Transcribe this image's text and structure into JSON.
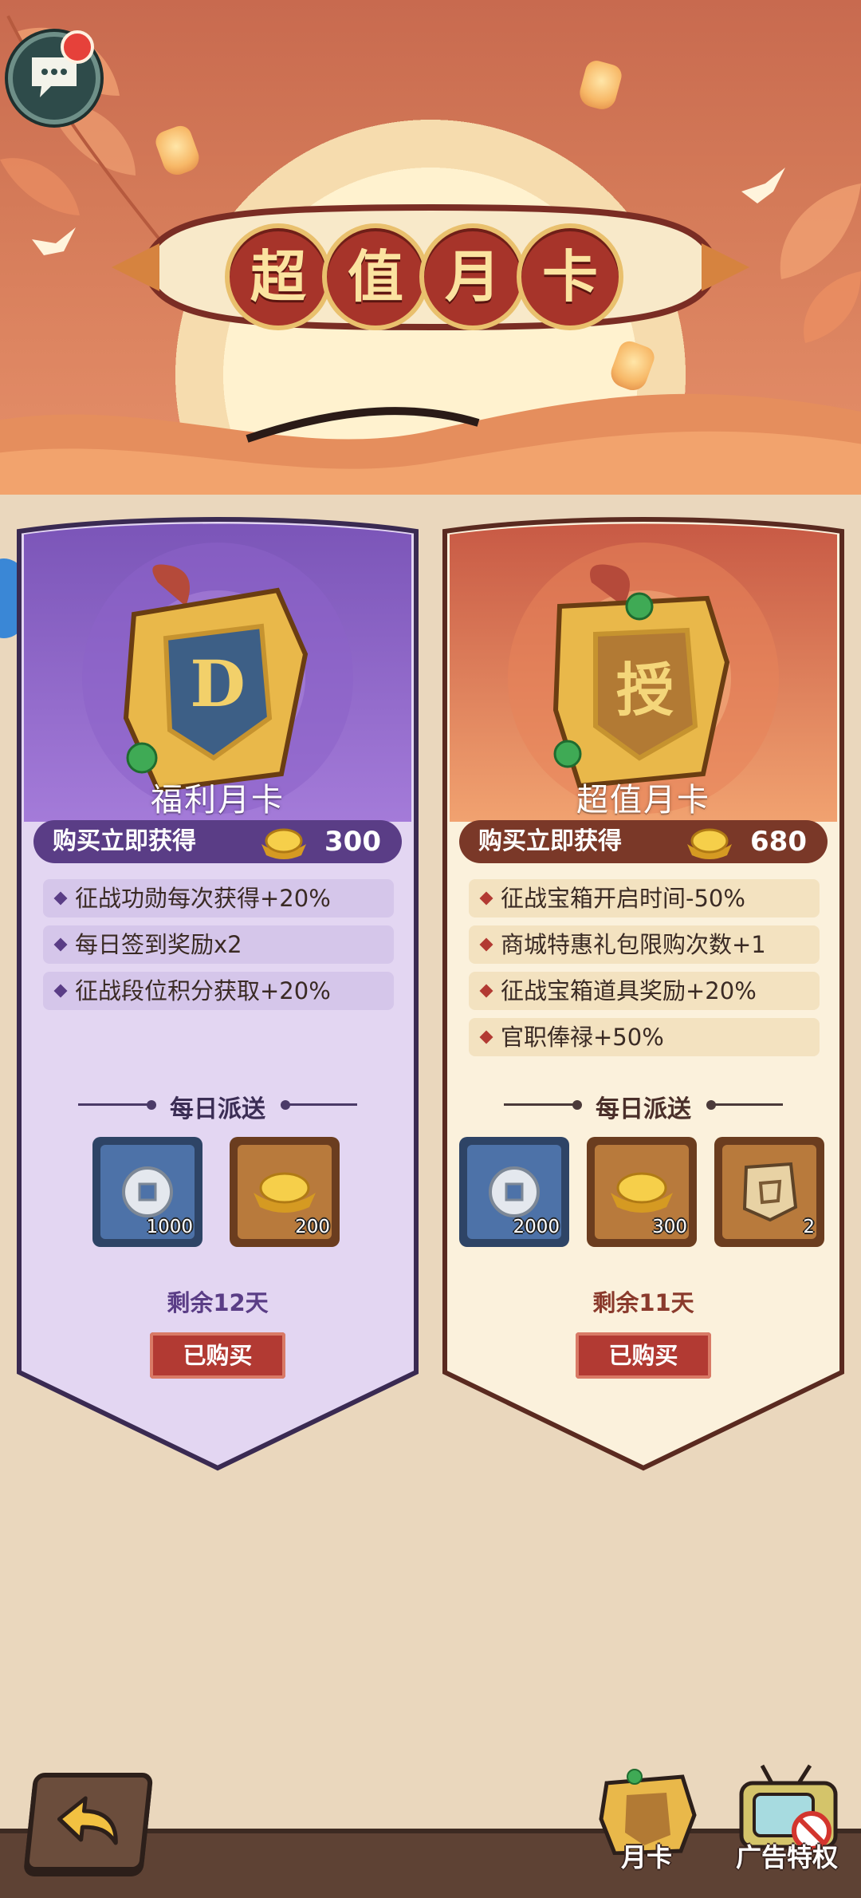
{
  "header": {
    "title_chars": [
      "超",
      "值",
      "月",
      "卡"
    ]
  },
  "cards": [
    {
      "name": "福利月卡",
      "emblem_glyph": "D",
      "instant_label": "购买立即获得",
      "instant_amount": "300",
      "benefits": [
        "征战功勋每次获得+20%",
        "每日签到奖励x2",
        "征战段位积分获取+20%"
      ],
      "daily_title": "每日派送",
      "rewards": [
        {
          "icon": "coin-icon",
          "count": "1000"
        },
        {
          "icon": "gold-ingot-icon",
          "count": "200"
        }
      ],
      "remaining": "剩余12天",
      "status_button": "已购买"
    },
    {
      "name": "超值月卡",
      "emblem_glyph": "授",
      "instant_label": "购买立即获得",
      "instant_amount": "680",
      "benefits": [
        "征战宝箱开启时间-50%",
        "商城特惠礼包限购次数+1",
        "征战宝箱道具奖励+20%",
        "官职俸禄+50%"
      ],
      "daily_title": "每日派送",
      "rewards": [
        {
          "icon": "coin-icon",
          "count": "2000"
        },
        {
          "icon": "gold-ingot-icon",
          "count": "300"
        },
        {
          "icon": "scroll-token-icon",
          "count": "2"
        }
      ],
      "remaining": "剩余11天",
      "status_button": "已购买"
    }
  ],
  "nav": {
    "tab_month_card": "月卡",
    "tab_ad_privilege": "广告特权"
  },
  "colors": {
    "purple_card": "#e3d6f2",
    "gold_card": "#fbf1dc",
    "accent_red": "#b23a33"
  }
}
